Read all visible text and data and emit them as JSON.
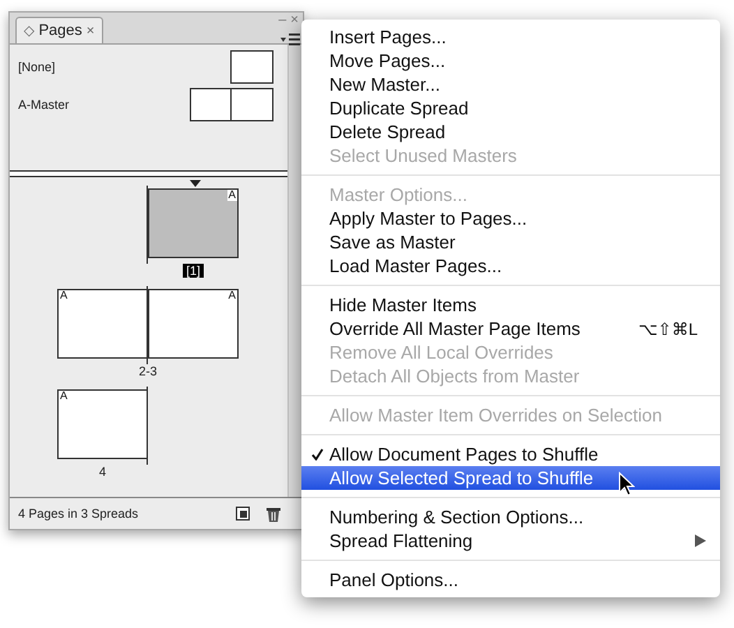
{
  "panel": {
    "tab": {
      "icon": "◇",
      "label": "Pages",
      "close": "×",
      "selected": true
    },
    "window_controls": [
      "–",
      "×"
    ],
    "masters": [
      {
        "name": "[None]",
        "pages": [
          {
            "kind": "right"
          }
        ]
      },
      {
        "name": "A-Master",
        "pages": [
          {
            "kind": "left"
          },
          {
            "kind": "right"
          }
        ]
      }
    ],
    "spreads": [
      {
        "label": "[1]",
        "selected": true,
        "pages": [
          {
            "kind": "right",
            "master": "A"
          }
        ]
      },
      {
        "label": "2-3",
        "selected": false,
        "pages": [
          {
            "kind": "left",
            "master": "A"
          },
          {
            "kind": "right",
            "master": "A"
          }
        ]
      },
      {
        "label": "4",
        "selected": false,
        "pages": [
          {
            "kind": "left",
            "master": "A"
          }
        ]
      }
    ],
    "status": "4 Pages in 3 Spreads"
  },
  "menu": {
    "groups": [
      {
        "items": [
          {
            "label": "Insert Pages...",
            "disabled": false,
            "checked": false,
            "selected": false,
            "submenu": false
          },
          {
            "label": "Move Pages...",
            "disabled": false,
            "checked": false,
            "selected": false,
            "submenu": false
          },
          {
            "label": "New Master...",
            "disabled": false,
            "checked": false,
            "selected": false,
            "submenu": false
          },
          {
            "label": "Duplicate Spread",
            "disabled": false,
            "checked": false,
            "selected": false,
            "submenu": false
          },
          {
            "label": "Delete Spread",
            "disabled": false,
            "checked": false,
            "selected": false,
            "submenu": false
          },
          {
            "label": "Select Unused Masters",
            "disabled": true,
            "checked": false,
            "selected": false,
            "submenu": false
          }
        ]
      },
      {
        "items": [
          {
            "label": "Master Options...",
            "disabled": true,
            "checked": false,
            "selected": false,
            "submenu": false
          },
          {
            "label": "Apply Master to Pages...",
            "disabled": false,
            "checked": false,
            "selected": false,
            "submenu": false
          },
          {
            "label": "Save as Master",
            "disabled": false,
            "checked": false,
            "selected": false,
            "submenu": false
          },
          {
            "label": "Load Master Pages...",
            "disabled": false,
            "checked": false,
            "selected": false,
            "submenu": false
          }
        ]
      },
      {
        "items": [
          {
            "label": "Hide Master Items",
            "disabled": false,
            "checked": false,
            "selected": false,
            "submenu": false
          },
          {
            "label": "Override All Master Page Items",
            "shortcut": "⌥⇧⌘L",
            "disabled": false,
            "checked": false,
            "selected": false,
            "submenu": false
          },
          {
            "label": "Remove All Local Overrides",
            "disabled": true,
            "checked": false,
            "selected": false,
            "submenu": false
          },
          {
            "label": "Detach All Objects from Master",
            "disabled": true,
            "checked": false,
            "selected": false,
            "submenu": false
          }
        ]
      },
      {
        "items": [
          {
            "label": "Allow Master Item Overrides on Selection",
            "disabled": true,
            "checked": false,
            "selected": false,
            "submenu": false
          }
        ]
      },
      {
        "items": [
          {
            "label": "Allow Document Pages to Shuffle",
            "disabled": false,
            "checked": true,
            "selected": false,
            "submenu": false
          },
          {
            "label": "Allow Selected Spread to Shuffle",
            "disabled": false,
            "checked": false,
            "selected": true,
            "submenu": false
          }
        ]
      },
      {
        "items": [
          {
            "label": "Numbering & Section Options...",
            "disabled": false,
            "checked": false,
            "selected": false,
            "submenu": false
          },
          {
            "label": "Spread Flattening",
            "disabled": false,
            "checked": false,
            "selected": false,
            "submenu": true
          }
        ]
      },
      {
        "items": [
          {
            "label": "Panel Options...",
            "disabled": false,
            "checked": false,
            "selected": false,
            "submenu": false
          }
        ]
      }
    ]
  }
}
